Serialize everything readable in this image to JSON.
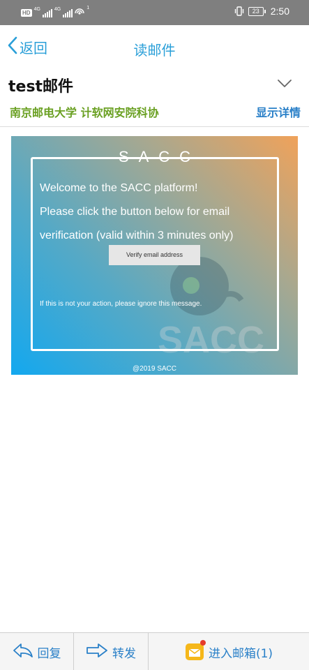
{
  "status_bar": {
    "hd": "HD",
    "net1": "4G",
    "net2": "4G",
    "notif": "1",
    "battery": "23",
    "time": "2:50"
  },
  "nav": {
    "back_label": "返回",
    "title": "读邮件"
  },
  "header": {
    "subject": "test邮件",
    "sender": "南京邮电大学 计软网安院科协",
    "details_label": "显示详情"
  },
  "email": {
    "brand": "SACC",
    "welcome_lines": [
      "Welcome to the SACC platform!",
      "Please click the button below for email",
      "verification (valid within 3 minutes only)"
    ],
    "verify_button": "Verify email address",
    "ignore_note": "If this is not your action, please ignore this message.",
    "copyright": "@2019 SACC"
  },
  "toolbar": {
    "reply_label": "回复",
    "forward_label": "转发",
    "inbox_label": "进入邮箱(1)"
  },
  "colors": {
    "accent": "#2a9fd8",
    "sender": "#6aa022",
    "link": "#2a80c8",
    "badge": "#e53b2c"
  },
  "icons": [
    "hd-icon",
    "signal-icon",
    "hotspot-icon",
    "vibrate-icon",
    "battery-icon",
    "back-chevron-icon",
    "chevron-down-icon",
    "reply-arrow-icon",
    "forward-arrow-icon",
    "mail-icon"
  ]
}
